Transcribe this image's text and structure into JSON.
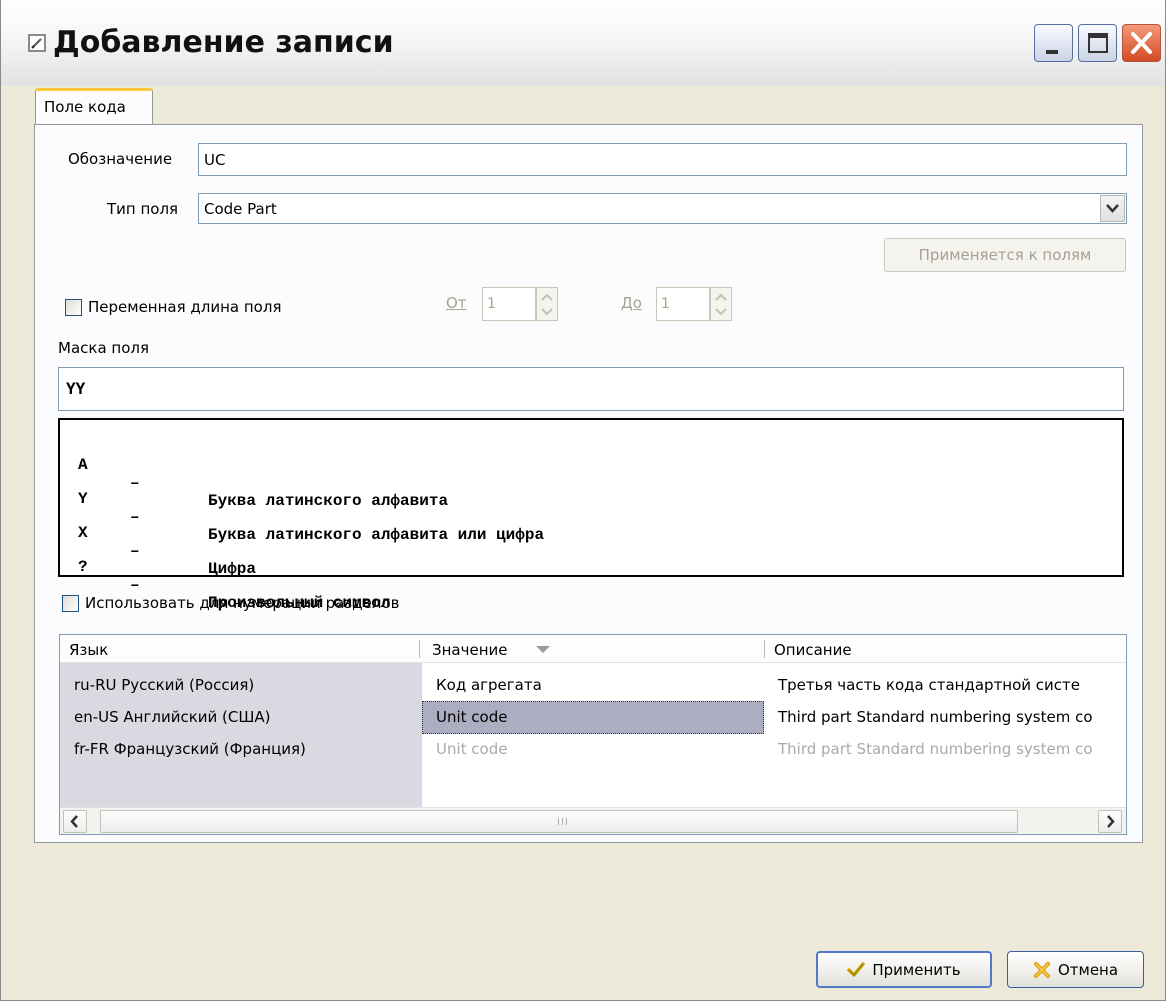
{
  "window": {
    "title": "Добавление записи"
  },
  "tabs": [
    {
      "label": "Поле кода",
      "active": true
    }
  ],
  "form": {
    "designation_label": "Обозначение",
    "designation_value": "UC",
    "field_type_label": "Тип поля",
    "field_type_value": "Code Part",
    "applies_button": "Применяется к полям",
    "variable_length_label": "Переменная длина поля",
    "variable_length_checked": false,
    "from_label": "От",
    "from_value": "1",
    "to_label": "До",
    "to_value": "1",
    "mask_label": "Маска поля",
    "mask_value": "YY",
    "legend": [
      {
        "key": "A",
        "dash": "–",
        "text": "Буква латинского алфавита"
      },
      {
        "key": "Y",
        "dash": "–",
        "text": "Буква латинского алфавита или цифра"
      },
      {
        "key": "X",
        "dash": "–",
        "text": "Цифра"
      },
      {
        "key": "?",
        "dash": "–",
        "text": "Произвольный символ"
      }
    ],
    "section_numbering_label": "Использовать для нумерации разделов",
    "section_numbering_checked": false
  },
  "grid": {
    "columns": [
      "Язык",
      "Значение",
      "Описание"
    ],
    "rows": [
      {
        "lang": "ru-RU  Русский (Россия)",
        "value": "Код агрегата",
        "desc": "Третья часть кода стандартной систе"
      },
      {
        "lang": "en-US  Английский (США)",
        "value": "Unit code",
        "desc": "Third part Standard numbering system co"
      },
      {
        "lang": "fr-FR  Французский (Франция)",
        "value": "Unit code",
        "desc": "Third part Standard numbering system co"
      }
    ],
    "scroll_grip": "III"
  },
  "buttons": {
    "apply": "Применить",
    "cancel": "Отмена"
  },
  "colors": {
    "tab_accent": "#ffc83c",
    "selection": "#adadc2",
    "close_button": "#d44a24"
  }
}
